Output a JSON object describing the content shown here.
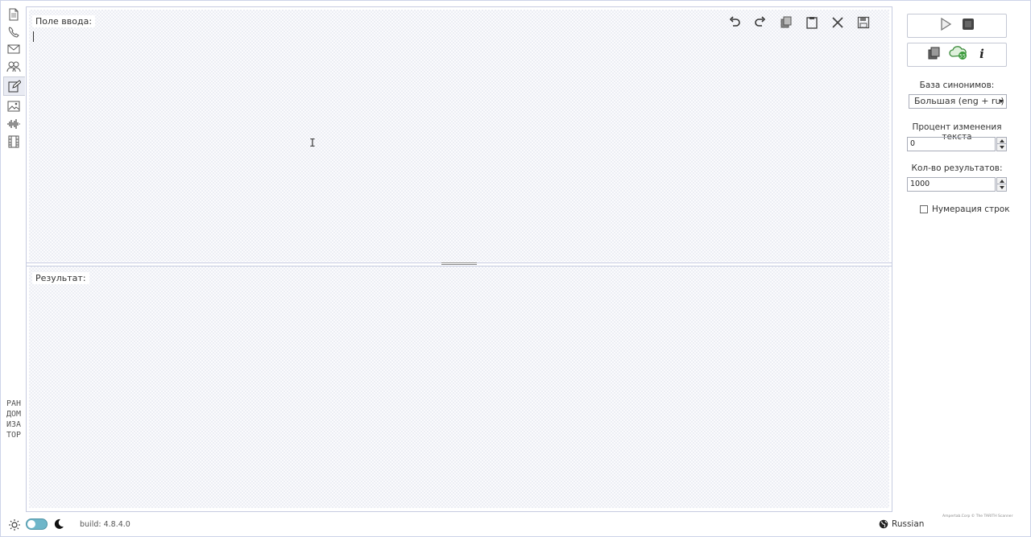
{
  "left_toolbar": {
    "vertical_title": "РАНДОМИЗАТОР",
    "icons": [
      "document-icon",
      "phone-icon",
      "mail-icon",
      "users-icon",
      "edit-icon",
      "image-icon",
      "audio-wave-icon",
      "film-icon"
    ]
  },
  "input_panel": {
    "label": "Поле ввода:"
  },
  "output_panel": {
    "label": "Результат:"
  },
  "edit_toolbar": [
    "undo-icon",
    "redo-icon",
    "copy-icon",
    "paste-icon",
    "clear-icon",
    "save-icon"
  ],
  "sidebar": {
    "synonyms_label": "База синонимов:",
    "synonyms_selected": "Большая (eng + ru)",
    "percent_label": "Процент изменения текста",
    "percent_value": "0",
    "results_label": "Кол-во результатов:",
    "results_value": "1000",
    "numbering_label": "Нумерация строк",
    "numbering_checked": false
  },
  "footer": {
    "build": "build: 4.8.4.0",
    "language": "Russian",
    "credit": "Ampertab.Corp © The TARITH Scanner"
  }
}
